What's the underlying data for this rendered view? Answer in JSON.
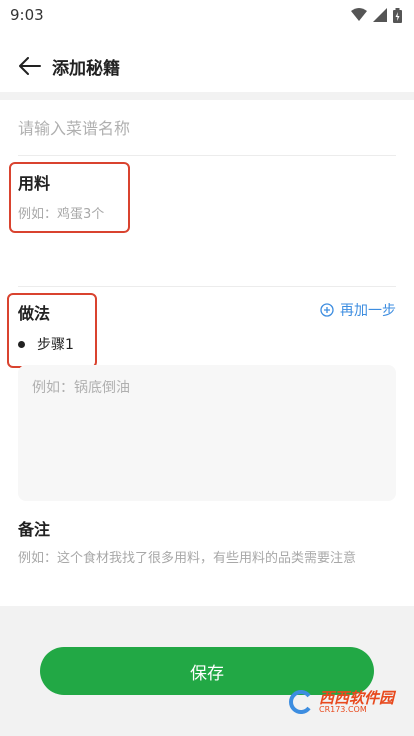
{
  "status_bar": {
    "time": "9:03"
  },
  "header": {
    "title": "添加秘籍"
  },
  "recipe_name": {
    "placeholder": "请输入菜谱名称"
  },
  "ingredients": {
    "title": "用料",
    "hint": "例如：鸡蛋3个"
  },
  "method": {
    "title": "做法",
    "add_step_label": "再加一步",
    "steps": [
      {
        "label": "步骤1",
        "placeholder": "例如：锅底倒油"
      }
    ]
  },
  "notes": {
    "title": "备注",
    "hint": "例如：这个食材我找了很多用料，有些用料的品类需要注意"
  },
  "save_label": "保存",
  "watermark": {
    "brand": "西西软件园",
    "site": "CR173.COM"
  },
  "colors": {
    "accent_green": "#22a845",
    "link_blue": "#3d8de0",
    "annotation_red": "#d9432f"
  }
}
